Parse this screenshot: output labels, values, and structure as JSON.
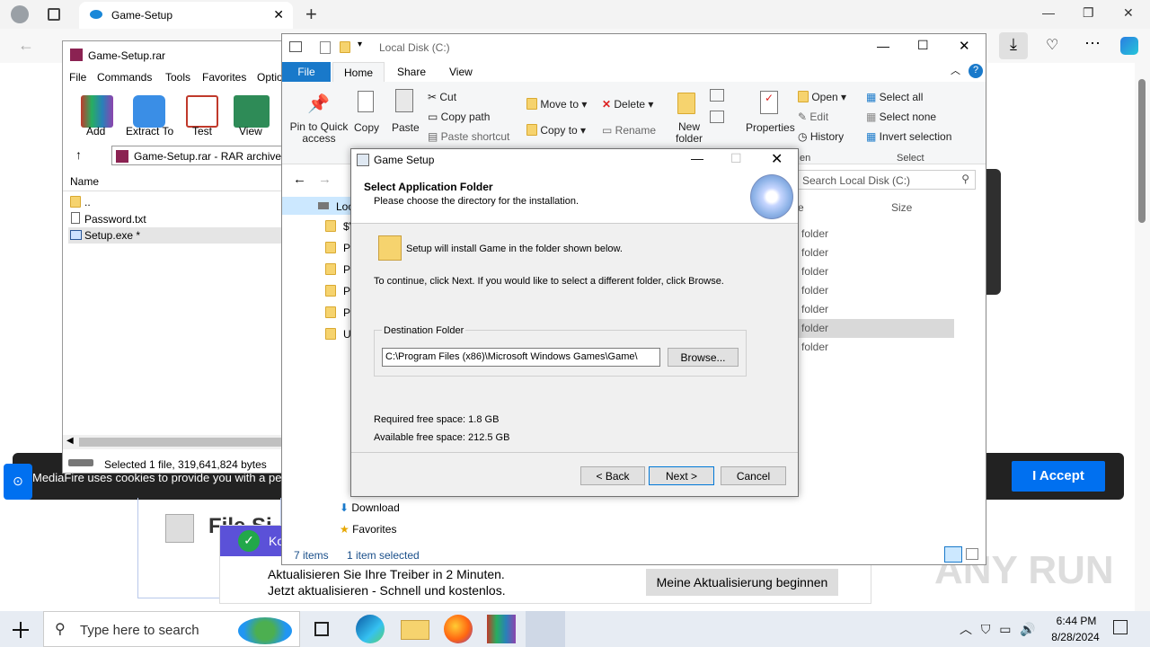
{
  "browser": {
    "tab_title": "Game-Setup",
    "new_tab": "+",
    "cookie_text": "MediaFire uses cookies to provide you with a per",
    "accept_label": "I Accept",
    "ad_line1": "Aktualisieren Sie Ihre Treiber in 2 Minuten.",
    "ad_line2": "Jetzt aktualisieren - Schnell und kostenlos.",
    "ad_button": "Meine Aktualisierung beginnen",
    "ad_badge": "Ko",
    "file_label": "File Si",
    "watermark": "ANY RUN"
  },
  "winrar": {
    "title": "Game-Setup.rar",
    "menu": [
      "File",
      "Commands",
      "Tools",
      "Favorites",
      "Optio"
    ],
    "toolbar": [
      "Add",
      "Extract To",
      "Test",
      "View"
    ],
    "path": "Game-Setup.rar - RAR archive, u",
    "col_name": "Name",
    "files": [
      "..",
      "Password.txt",
      "Setup.exe *"
    ],
    "status": "Selected 1 file, 319,641,824 bytes"
  },
  "explorer": {
    "title": "Local Disk (C:)",
    "tabs": [
      "File",
      "Home",
      "Share",
      "View"
    ],
    "pin": "Pin to Quick access",
    "copy": "Copy",
    "paste": "Paste",
    "cut": "Cut",
    "copy_path": "Copy path",
    "paste_shortcut": "Paste shortcut",
    "move_to": "Move to",
    "copy_to": "Copy to",
    "delete": "Delete",
    "rename": "Rename",
    "new_folder": "New folder",
    "properties": "Properties",
    "open": "Open",
    "edit": "Edit",
    "history": "History",
    "select_all": "Select all",
    "select_none": "Select none",
    "invert_selection": "Invert selection",
    "group_select": "Select",
    "group_open": "en",
    "search": "Search Local Disk (C:)",
    "col_type": "e",
    "col_size": "Size",
    "nav_root": "Loc",
    "nav_items": [
      "$V",
      "P",
      "P",
      "P",
      "P",
      "U"
    ],
    "nav_download": "Download",
    "nav_favorites": "Favorites",
    "type_values": [
      "folder",
      "folder",
      "folder",
      "folder",
      "folder",
      "folder",
      "folder"
    ],
    "status_items": "7 items",
    "status_selected": "1 item selected"
  },
  "dialog": {
    "title": "Game Setup",
    "heading": "Select Application Folder",
    "subheading": "Please choose the directory for the installation.",
    "info": "Setup will install Game in the folder shown below.",
    "continue_text": "To continue, click Next. If you would like to select a different folder, click Browse.",
    "dest_label": "Destination Folder",
    "dest_value": "C:\\Program Files (x86)\\Microsoft Windows Games\\Game\\",
    "browse": "Browse...",
    "required": "Required free space: 1.8 GB",
    "available": "Available free space: 212.5 GB",
    "back": "< Back",
    "next": "Next >",
    "cancel": "Cancel"
  },
  "taskbar": {
    "search_placeholder": "Type here to search",
    "time": "6:44 PM",
    "date": "8/28/2024"
  }
}
